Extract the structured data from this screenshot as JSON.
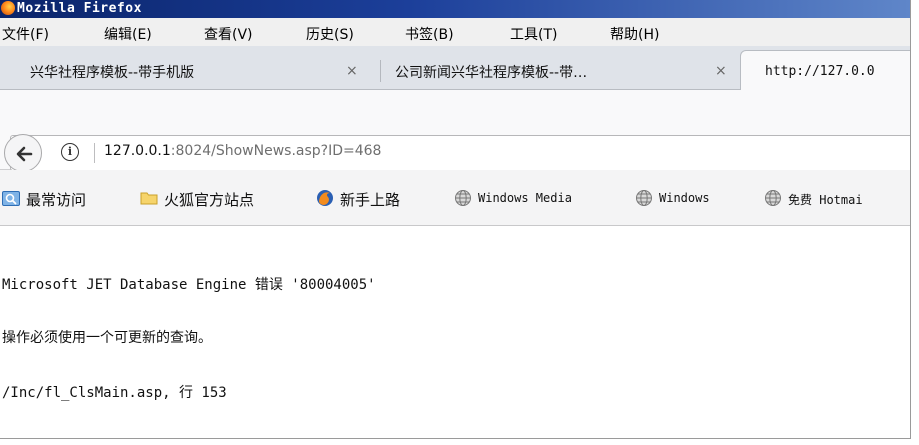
{
  "window": {
    "title": "Mozilla Firefox"
  },
  "menu": [
    {
      "label": "文件(F)"
    },
    {
      "label": "编辑(E)"
    },
    {
      "label": "查看(V)"
    },
    {
      "label": "历史(S)"
    },
    {
      "label": "书签(B)"
    },
    {
      "label": "工具(T)"
    },
    {
      "label": "帮助(H)"
    }
  ],
  "tabs": [
    {
      "label": "兴华社程序模板--带手机版",
      "close": "×"
    },
    {
      "label": "公司新闻兴华社程序模板--带…",
      "close": "×"
    },
    {
      "label": "http://127.0.0"
    }
  ],
  "urlbar": {
    "host": "127.0.0.1",
    "rest": ":8024/ShowNews.asp?ID=468"
  },
  "bookmarks": [
    {
      "label": "最常访问",
      "icon": "most-visited-icon"
    },
    {
      "label": "火狐官方站点",
      "icon": "folder-icon"
    },
    {
      "label": "新手上路",
      "icon": "firefox-icon"
    },
    {
      "label": "Windows Media",
      "icon": "globe-icon"
    },
    {
      "label": "Windows",
      "icon": "globe-icon"
    },
    {
      "label": "免费 Hotmai",
      "icon": "globe-icon"
    }
  ],
  "content": {
    "error_line": "Microsoft JET Database Engine 错误 '80004005'",
    "message": "操作必须使用一个可更新的查询。",
    "location": "/Inc/fl_ClsMain.asp, 行 153"
  }
}
